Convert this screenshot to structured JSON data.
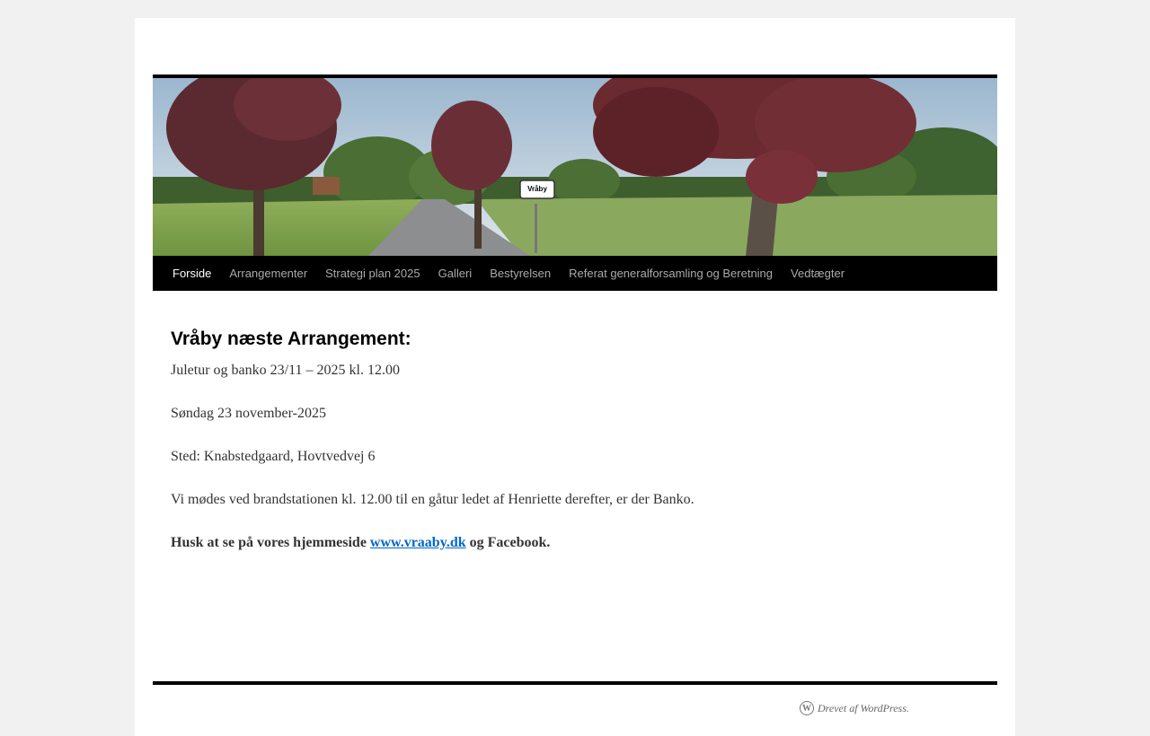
{
  "banner": {
    "image_alt": "Village road with Vråby sign and trees",
    "sign_text": "Vråby"
  },
  "nav": {
    "items": [
      {
        "label": "Forside",
        "current": true
      },
      {
        "label": "Arrangementer",
        "current": false
      },
      {
        "label": "Strategi plan 2025",
        "current": false
      },
      {
        "label": "Galleri",
        "current": false
      },
      {
        "label": "Bestyrelsen",
        "current": false
      },
      {
        "label": "Referat generalforsamling og Beretning",
        "current": false
      },
      {
        "label": "Vedtægter",
        "current": false
      }
    ]
  },
  "post": {
    "title": "Vråby næste Arrangement:",
    "line1": "Juletur og banko 23/11 – 2025 kl. 12.00",
    "line2": "Søndag 23 november-2025",
    "line3": "Sted: Knabstedgaard, Hovtvedvej 6",
    "line4": "Vi mødes ved brandstationen kl. 12.00 til en gåtur ledet af Henriette derefter, er der Banko.",
    "note_prefix": "Husk at se på vores hjemmeside ",
    "note_link": "www.vraaby.dk",
    "note_suffix": " og Facebook."
  },
  "footer": {
    "generator_text": "Drevet af WordPress.",
    "icon": "wordpress-icon"
  },
  "colors": {
    "nav_bg": "#000000",
    "link": "#0066cc",
    "page_bg": "#f1f1f1"
  }
}
